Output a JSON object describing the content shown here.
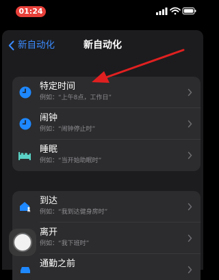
{
  "status_bar": {
    "time": "01:24"
  },
  "nav": {
    "back_label": "新自动化",
    "title": "新自动化"
  },
  "group1": [
    {
      "label": "特定时间",
      "example": "例如：“上午8点，工作日”",
      "icon": "clock-icon",
      "icon_color": "#1e88ff"
    },
    {
      "label": "闹钟",
      "example": "例如：“闹钟停止时”",
      "icon": "alarm-clock-icon",
      "icon_color": "#1e88ff"
    },
    {
      "label": "睡眠",
      "example": "例如：“当开始助眠时”",
      "icon": "bed-icon",
      "icon_color": "#5ad1c4"
    }
  ],
  "group2": [
    {
      "label": "到达",
      "example": "例如：“我到达健身房时”",
      "icon": "home-arrive-icon",
      "icon_color": "#1e88ff"
    },
    {
      "label": "离开",
      "example": "例如：“我下班时”",
      "icon": "home-leave-icon",
      "icon_color": "#1e88ff"
    },
    {
      "label": "通勤之前",
      "example": "",
      "icon": "car-icon",
      "icon_color": "#1e88ff"
    }
  ],
  "colors": {
    "accent": "#3b8bff",
    "annotation_arrow": "#e02020",
    "time_pill": "#e8403a"
  }
}
